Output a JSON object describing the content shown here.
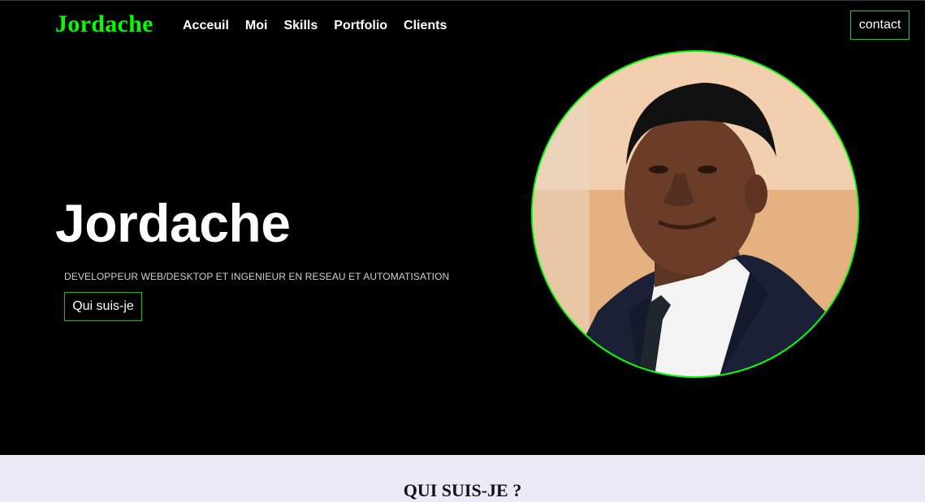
{
  "header": {
    "brand": "Jordache",
    "nav": [
      "Acceuil",
      "Moi",
      "Skills",
      "Portfolio",
      "Clients"
    ],
    "contact_label": "contact"
  },
  "hero": {
    "title": "Jordache",
    "subtitle": "DEVELOPPEUR WEB/DESKTOP ET INGENIEUR EN RESEAU ET AUTOMATISATION",
    "cta_label": "Qui suis-je"
  },
  "about": {
    "title": "QUI SUIS-JE ?"
  },
  "colors": {
    "accent": "#00ff00",
    "background": "#000000",
    "section_bg": "#ebebf8"
  }
}
